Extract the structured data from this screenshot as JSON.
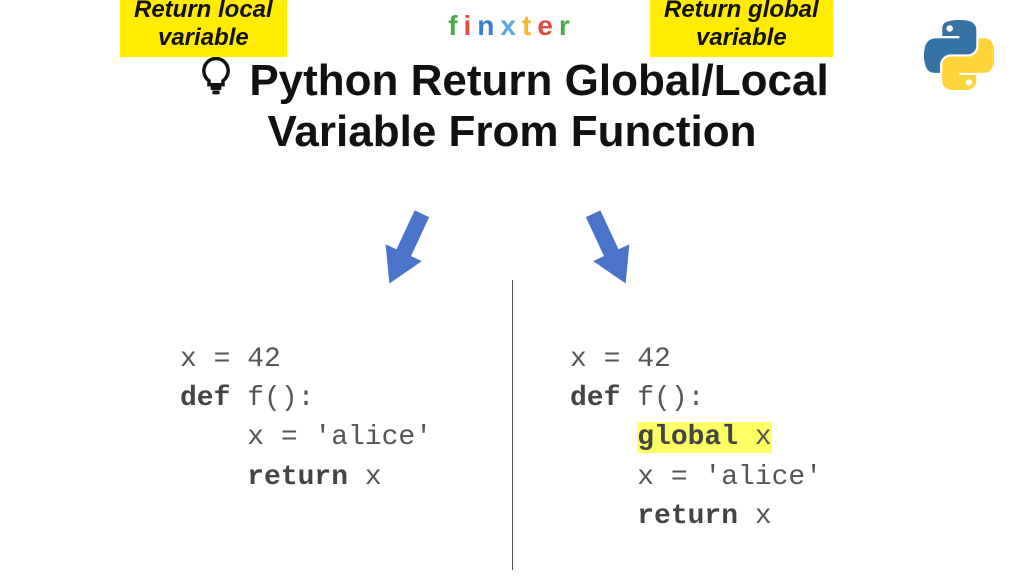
{
  "brand": {
    "letters": [
      "f",
      "i",
      "n",
      "x",
      "t",
      "e",
      "r"
    ],
    "colors": [
      "#4ea94b",
      "#e74c3c",
      "#3b7fd1",
      "#5aa7e0",
      "#f2bb2f",
      "#e74c3c",
      "#4ea94b"
    ]
  },
  "title": {
    "line1": "Python Return Global/Local",
    "line2": "Variable From Function"
  },
  "labels": {
    "left_line1": "Return local",
    "left_line2": "variable",
    "right_line1": "Return global",
    "right_line2": "variable"
  },
  "code": {
    "left": {
      "l1a": "x = 42",
      "l2a": "def",
      "l2b": " f():",
      "l3a": "    x = 'alice'",
      "l4a": "    ",
      "l4b": "return",
      "l4c": " x"
    },
    "right": {
      "l1a": "x = 42",
      "l2a": "def",
      "l2b": " f():",
      "l3a": "    ",
      "l3b": "global",
      "l3c": " x",
      "l4a": "    x = 'alice'",
      "l5a": "    ",
      "l5b": "return",
      "l5c": " x"
    }
  },
  "icons": {
    "bulb": "lightbulb-icon",
    "python": "python-logo",
    "arrow": "arrow-down-icon"
  },
  "colors": {
    "highlight": "#ffec00",
    "arrow": "#4a74c9"
  }
}
